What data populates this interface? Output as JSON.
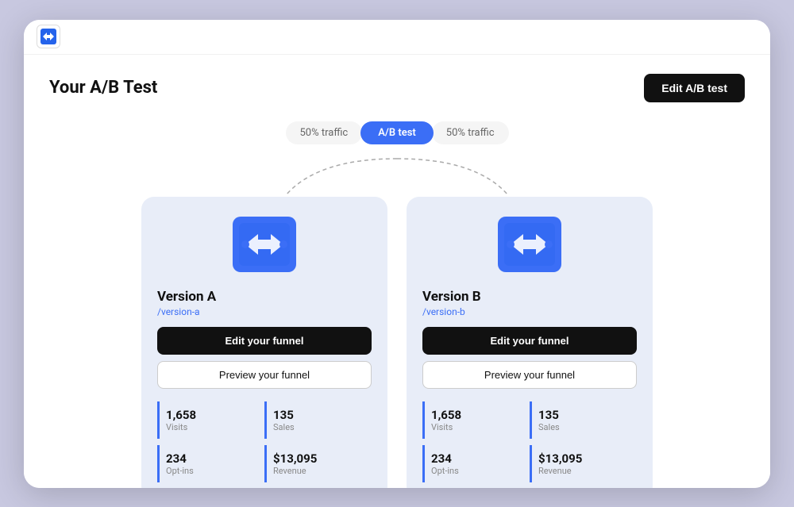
{
  "logo": {
    "alt": "App logo icon"
  },
  "header": {
    "title": "Your A/B Test",
    "edit_button_label": "Edit A/B test"
  },
  "traffic_bar": {
    "left_label": "50% traffic",
    "center_badge": "A/B test",
    "right_label": "50% traffic"
  },
  "versions": [
    {
      "id": "version-a",
      "name": "Version A",
      "url": "/version-a",
      "edit_funnel_label": "Edit your funnel",
      "preview_funnel_label": "Preview your funnel",
      "stats": [
        {
          "value": "1,658",
          "label": "Visits"
        },
        {
          "value": "135",
          "label": "Sales"
        },
        {
          "value": "234",
          "label": "Opt-ins"
        },
        {
          "value": "$13,095",
          "label": "Revenue"
        }
      ]
    },
    {
      "id": "version-b",
      "name": "Version B",
      "url": "/version-b",
      "edit_funnel_label": "Edit your funnel",
      "preview_funnel_label": "Preview your funnel",
      "stats": [
        {
          "value": "1,658",
          "label": "Visits"
        },
        {
          "value": "135",
          "label": "Sales"
        },
        {
          "value": "234",
          "label": "Opt-ins"
        },
        {
          "value": "$13,095",
          "label": "Revenue"
        }
      ]
    }
  ]
}
